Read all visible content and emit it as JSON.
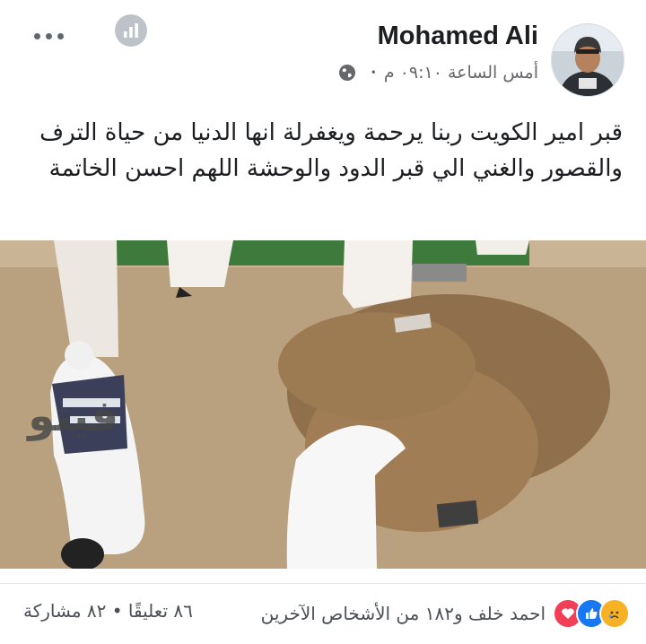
{
  "post": {
    "author": "Mohamed Ali",
    "timestamp": "أمس الساعة ٠٩:١٠ م",
    "separator": "•",
    "audience_icon": "globe-icon",
    "text": "قبر امير الكويت ربنا يرحمة ويغفرلة انها الدنيا من حياة الترف والقصور والغني الي قبر الدود والوحشة اللهم احسن الخاتمة",
    "photo_watermark": "فيتو"
  },
  "header": {
    "more_icon": "more-options-icon",
    "insights_icon": "insights-icon"
  },
  "footer": {
    "reaction_icons": [
      "love-reaction-icon",
      "like-reaction-icon",
      "sad-reaction-icon"
    ],
    "reactions_text": "احمد خلف و١٨٢ من الأشخاص الآخرين",
    "comments": "٨٦ تعليقًا",
    "dot": "•",
    "shares": "٨٢ مشاركة"
  },
  "colors": {
    "love": "#f33e58",
    "like": "#1877f2",
    "sad": "#f7b125",
    "secondary_text": "#65676b"
  }
}
